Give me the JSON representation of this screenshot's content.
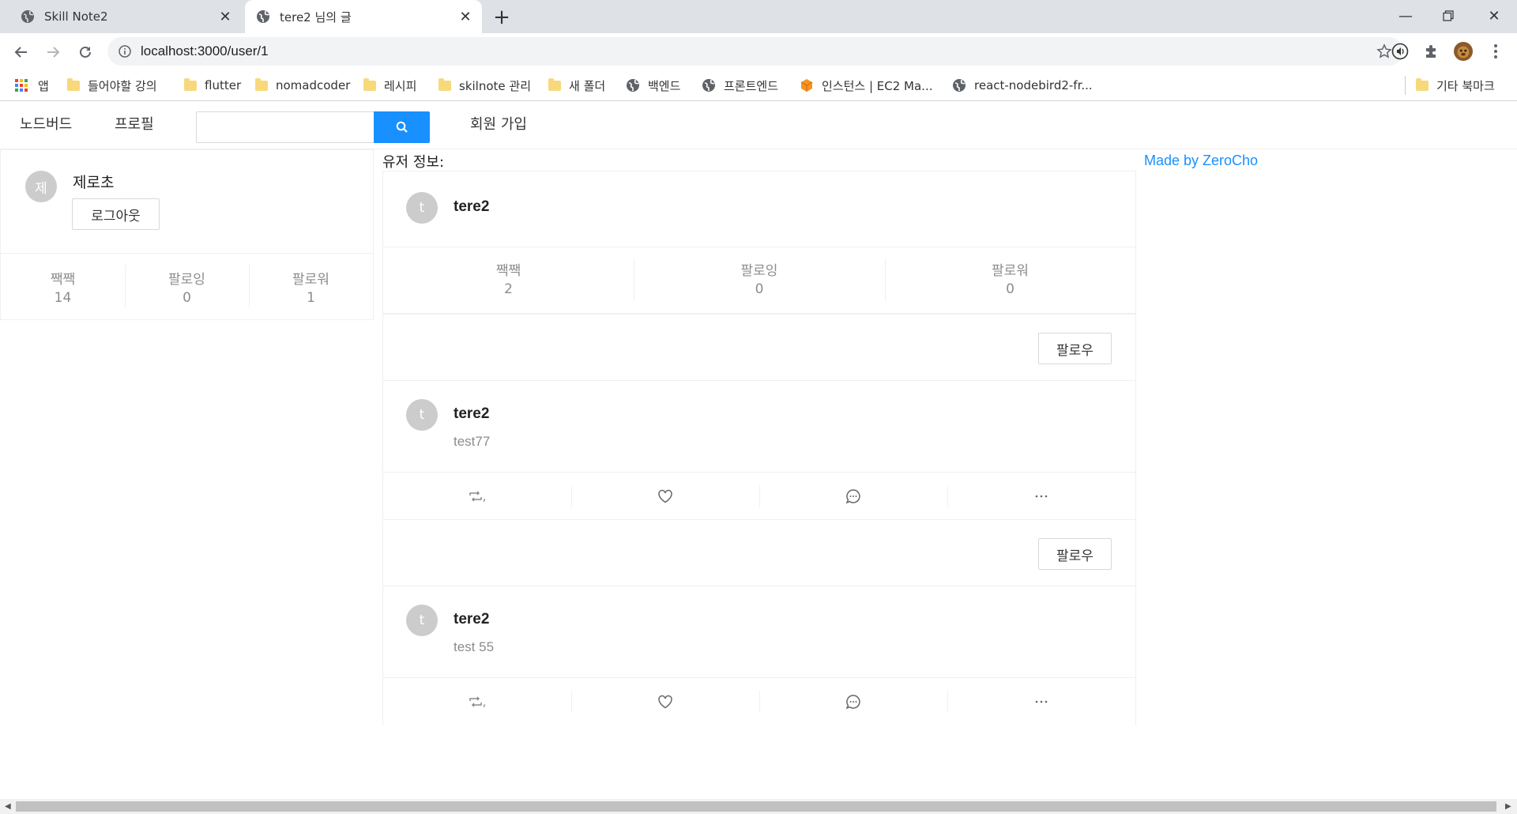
{
  "browser": {
    "tabs": [
      {
        "title": "Skill Note2",
        "active": false
      },
      {
        "title": "tere2 님의 글",
        "active": true
      }
    ],
    "url": "localhost:3000/user/1",
    "bookmarks": [
      {
        "label": "앱",
        "icon": "apps-icon"
      },
      {
        "label": "들어야할 강의",
        "icon": "folder-icon"
      },
      {
        "label": "flutter",
        "icon": "folder-icon"
      },
      {
        "label": "nomadcoder",
        "icon": "folder-icon"
      },
      {
        "label": "레시피",
        "icon": "folder-icon"
      },
      {
        "label": "skilnote 관리",
        "icon": "folder-icon"
      },
      {
        "label": "새 폴더",
        "icon": "folder-icon"
      },
      {
        "label": "백엔드",
        "icon": "globe-icon"
      },
      {
        "label": "프론트엔드",
        "icon": "globe-icon"
      },
      {
        "label": "인스턴스 | EC2 Ma...",
        "icon": "aws-cube-icon"
      },
      {
        "label": "react-nodebird2-fr...",
        "icon": "globe-icon"
      },
      {
        "label": "기타 북마크",
        "icon": "folder-icon"
      }
    ]
  },
  "menu": {
    "home": "노드버드",
    "profile": "프로필",
    "search_value": "",
    "signup": "회원 가입"
  },
  "me": {
    "avatar_letter": "제",
    "nickname": "제로초",
    "logout_label": "로그아웃",
    "stats": [
      {
        "label": "짹짹",
        "value": "14"
      },
      {
        "label": "팔로잉",
        "value": "0"
      },
      {
        "label": "팔로워",
        "value": "1"
      }
    ]
  },
  "user_info_label": "유저 정보:",
  "made_by": "Made by ZeroCho",
  "profile": {
    "avatar_letter": "t",
    "nickname": "tere2",
    "stats": [
      {
        "label": "짹짹",
        "value": "2"
      },
      {
        "label": "팔로잉",
        "value": "0"
      },
      {
        "label": "팔로워",
        "value": "0"
      }
    ]
  },
  "posts": [
    {
      "follow_label": "팔로우",
      "avatar_letter": "t",
      "author": "tere2",
      "content": "test77",
      "retweet_suffix": ","
    },
    {
      "follow_label": "팔로우",
      "avatar_letter": "t",
      "author": "tere2",
      "content": "test 55",
      "retweet_suffix": ","
    }
  ],
  "colors": {
    "primary": "#1890ff",
    "avatar_bg": "#cccccc",
    "muted_text": "#8c8c8c"
  }
}
